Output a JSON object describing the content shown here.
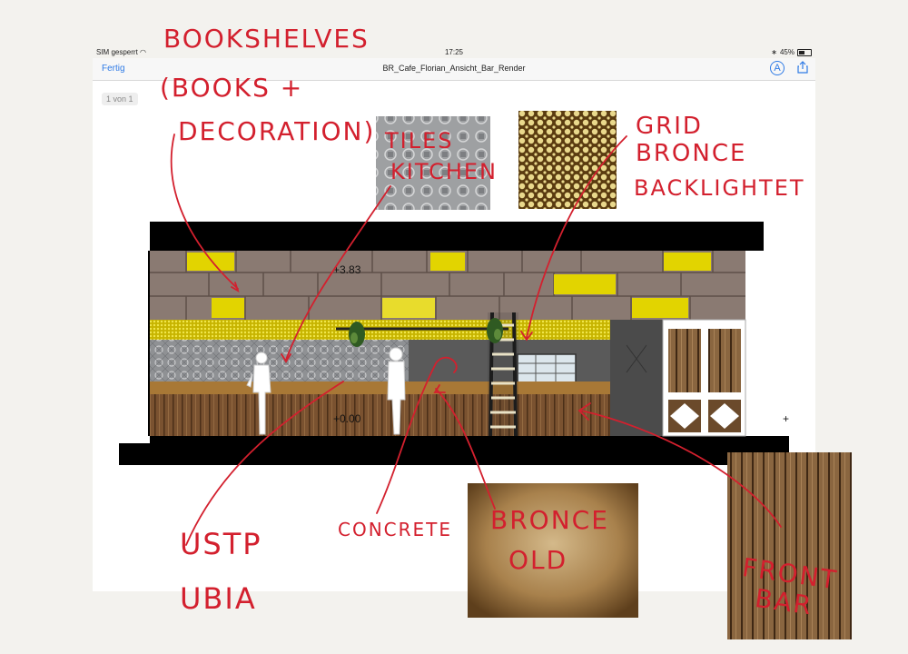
{
  "status_bar": {
    "carrier": "SIM gesperrt",
    "time": "17:25",
    "battery": "45%"
  },
  "nav_bar": {
    "done_label": "Fertig",
    "title": "BR_Cafe_Florian_Ansicht_Bar_Render"
  },
  "page_indicator": "1 von 1",
  "drawing": {
    "level_top": "+3.83",
    "level_bottom": "+0.00",
    "plus_mark": "+"
  },
  "annotations": {
    "bookshelves_line1": "BOOKSHELVES",
    "bookshelves_line2": "(BOOKS +",
    "bookshelves_line3": "DECORATION)",
    "tiles_line1": "TILES",
    "tiles_line2": "KITCHEN",
    "grid_line1": "GRID",
    "grid_line2": "BRONCE",
    "grid_line3": "BACKLIGHTET",
    "concrete": "CONCRETE",
    "bronce_line1": "BRONCE",
    "bronce_line2": "OLD",
    "ustp_line1": "USTP",
    "ustp_line2": "UBIA",
    "front_line1": "FRONT",
    "front_line2": "BAR"
  },
  "colors": {
    "accent": "#2f7be6",
    "annotation": "#d3202e",
    "frame": "#000000",
    "brick": "#8a7a72",
    "gold": "#e2d400",
    "wood": "#7a5230",
    "concrete": "#5a5a5a"
  }
}
